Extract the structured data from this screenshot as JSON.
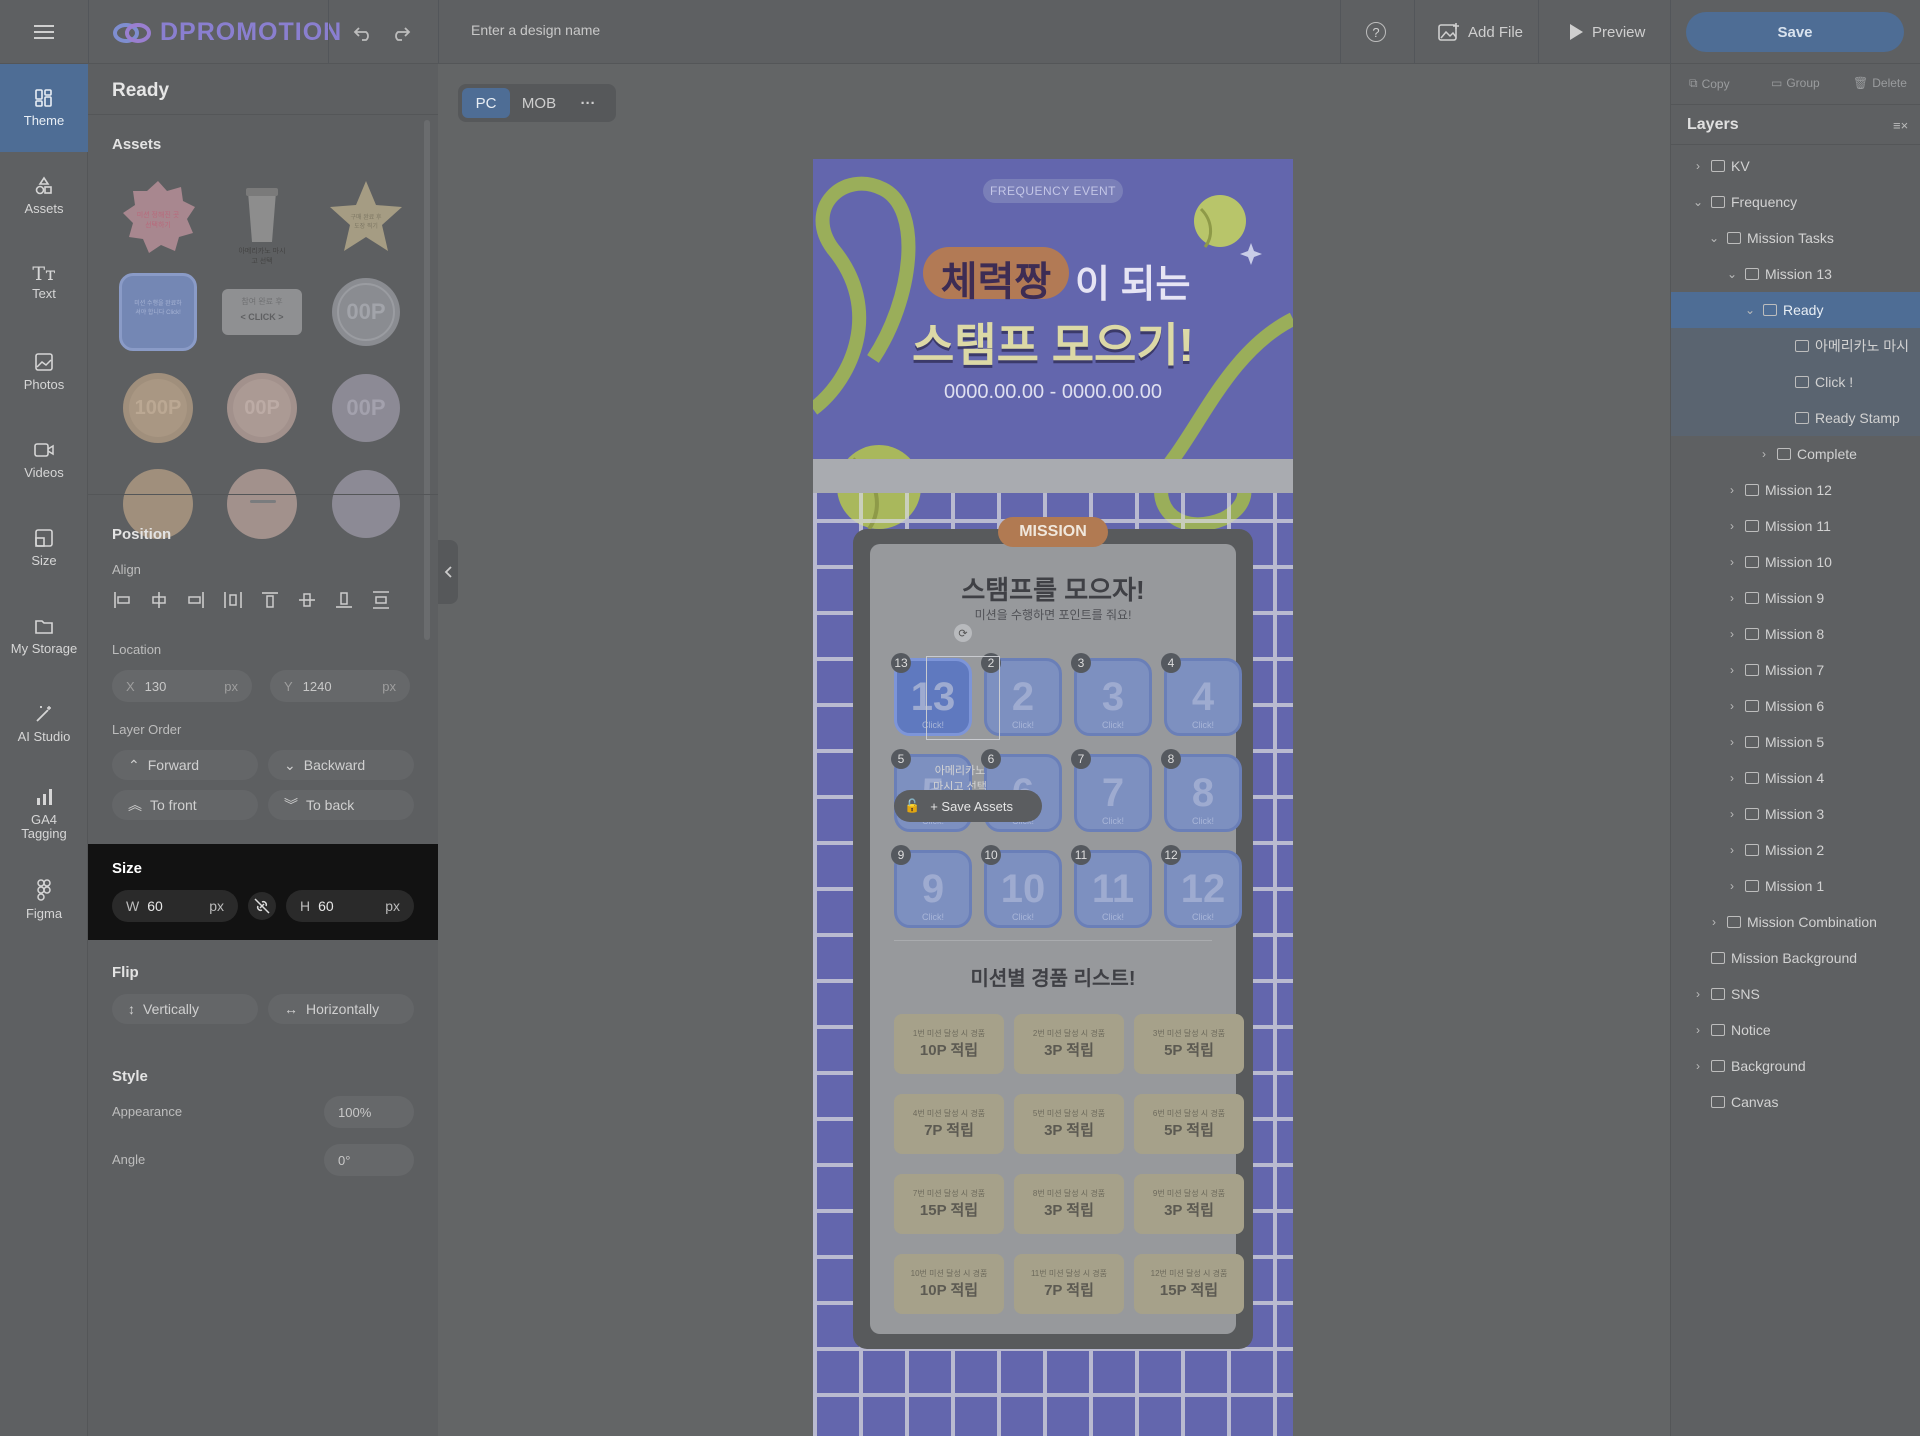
{
  "app": {
    "logo": "DPROMOTION",
    "design_name_placeholder": "Enter a design name",
    "help": "?",
    "add_file": "Add File",
    "preview": "Preview",
    "save": "Save"
  },
  "nav": {
    "items": [
      {
        "label": "Theme",
        "icon": "theme-icon"
      },
      {
        "label": "Assets",
        "icon": "assets-icon"
      },
      {
        "label": "Text",
        "icon": "text-icon"
      },
      {
        "label": "Photos",
        "icon": "photos-icon"
      },
      {
        "label": "Videos",
        "icon": "videos-icon"
      },
      {
        "label": "Size",
        "icon": "size-icon"
      },
      {
        "label": "My Storage",
        "icon": "folder-icon"
      },
      {
        "label": "AI Studio",
        "icon": "magic-wand-icon"
      },
      {
        "label": "GA4 Tagging",
        "icon": "bar-chart-icon"
      },
      {
        "label": "Figma",
        "icon": "figma-icon"
      }
    ]
  },
  "panel": {
    "title": "Ready",
    "assets_heading": "Assets",
    "asset_texts": {
      "a1": "미션 정해진 곳 선택하기",
      "a2": "아메리카노 마시고 선택",
      "a3": "구매 완료 후 도장 찍기",
      "a4": "미션 수행을 완료하셔야 합니다 Click!",
      "a5": "참여 완료 후",
      "a5b": "< CLICK >",
      "a6": "00P",
      "a7": "100P",
      "a8": "00P",
      "a9": "00P"
    },
    "position_heading": "Position",
    "align_label": "Align",
    "location_label": "Location",
    "x_label": "X",
    "x_value": "130",
    "x_unit": "px",
    "y_label": "Y",
    "y_value": "1240",
    "y_unit": "px",
    "layer_order_label": "Layer Order",
    "forward": "Forward",
    "backward": "Backward",
    "to_front": "To front",
    "to_back": "To back",
    "size_heading": "Size",
    "w_label": "W",
    "w_value": "60",
    "w_unit": "px",
    "h_label": "H",
    "h_value": "60",
    "h_unit": "px",
    "flip_heading": "Flip",
    "vertically": "Vertically",
    "horizontally": "Horizontally",
    "style_heading": "Style",
    "appearance_label": "Appearance",
    "appearance_value": "100%",
    "angle_label": "Angle",
    "angle_value": "0°"
  },
  "canvas": {
    "pc": "PC",
    "mob": "MOB",
    "more": "···",
    "event_badge": "FREQUENCY EVENT",
    "headline_highlight": "체력짱",
    "headline_rest": "이 되는",
    "headline_line2": "스탬프 모으기!",
    "date_range": "0000.00.00 - 0000.00.00",
    "mission_tab": "MISSION",
    "stamp_title": "스탬프를 모으자!",
    "stamp_subtitle": "미션을 수행하면 포인트를 줘요!",
    "selected_stamp_text": "아메리카노 마시고 선택",
    "save_assets": "Save Assets",
    "prize_title": "미션별 경품 리스트!",
    "stamps": [
      "13",
      "2",
      "3",
      "4",
      "5",
      "6",
      "7",
      "8",
      "9",
      "10",
      "11",
      "12"
    ],
    "stamp_click": "Click!",
    "prizes": [
      {
        "small": "1번 미션 달성 시 경품",
        "big": "10P 적립"
      },
      {
        "small": "2번 미션 달성 시 경품",
        "big": "3P 적립"
      },
      {
        "small": "3번 미션 달성 시 경품",
        "big": "5P 적립"
      },
      {
        "small": "4번 미션 달성 시 경품",
        "big": "7P 적립"
      },
      {
        "small": "5번 미션 달성 시 경품",
        "big": "3P 적립"
      },
      {
        "small": "6번 미션 달성 시 경품",
        "big": "5P 적립"
      },
      {
        "small": "7번 미션 달성 시 경품",
        "big": "15P 적립"
      },
      {
        "small": "8번 미션 달성 시 경품",
        "big": "3P 적립"
      },
      {
        "small": "9번 미션 달성 시 경품",
        "big": "3P 적립"
      },
      {
        "small": "10번 미션 달성 시 경품",
        "big": "10P 적립"
      },
      {
        "small": "11번 미션 달성 시 경품",
        "big": "7P 적립"
      },
      {
        "small": "12번 미션 달성 시 경품",
        "big": "15P 적립"
      }
    ]
  },
  "layers": {
    "copy": "Copy",
    "group": "Group",
    "delete": "Delete",
    "title": "Layers",
    "rows": [
      {
        "label": "KV"
      },
      {
        "label": "Frequency"
      },
      {
        "label": "Mission Tasks"
      },
      {
        "label": "Mission 13"
      },
      {
        "label": "Ready"
      },
      {
        "label": "아메리카노 마시"
      },
      {
        "label": "Click !"
      },
      {
        "label": "Ready Stamp"
      },
      {
        "label": "Complete"
      },
      {
        "label": "Mission 12"
      },
      {
        "label": "Mission 11"
      },
      {
        "label": "Mission 10"
      },
      {
        "label": "Mission 9"
      },
      {
        "label": "Mission 8"
      },
      {
        "label": "Mission 7"
      },
      {
        "label": "Mission 6"
      },
      {
        "label": "Mission 5"
      },
      {
        "label": "Mission 4"
      },
      {
        "label": "Mission 3"
      },
      {
        "label": "Mission 2"
      },
      {
        "label": "Mission 1"
      },
      {
        "label": "Mission Combination"
      },
      {
        "label": "Mission Background"
      },
      {
        "label": "SNS"
      },
      {
        "label": "Notice"
      },
      {
        "label": "Background"
      },
      {
        "label": "Canvas"
      }
    ]
  }
}
